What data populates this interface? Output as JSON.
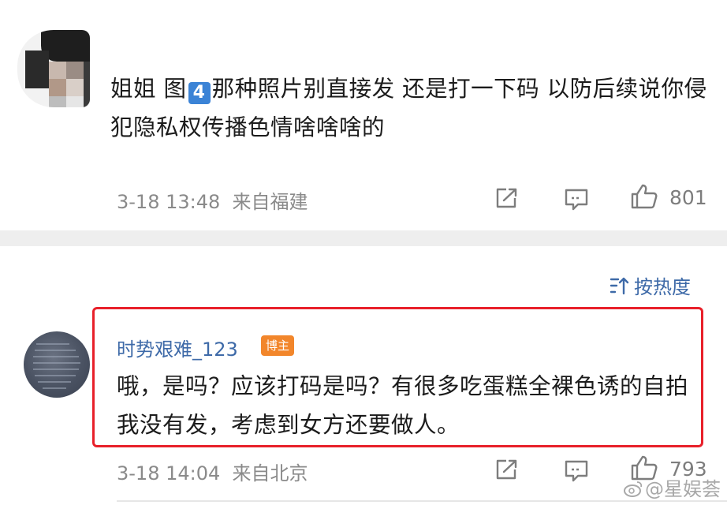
{
  "comment1": {
    "text_before": "姐姐 图",
    "num_badge": "4",
    "text_after": "那种照片别直接发 还是打一下码 以防后续说你侵犯隐私权传播色情啥啥啥的",
    "timestamp": "3-18 13:48",
    "location": "来自福建",
    "like_count": "801"
  },
  "sort": {
    "label": "按热度"
  },
  "comment2": {
    "username": "时势艰难_123",
    "badge": "博主",
    "text": "哦，是吗？应该打码是吗？有很多吃蛋糕全裸色诱的自拍我没有发，考虑到女方还要做人。",
    "timestamp": "3-18 14:04",
    "location": "来自北京",
    "like_count": "793"
  },
  "watermark": {
    "text": "@星娱荟"
  },
  "colors": {
    "link": "#3e6aa8",
    "highlight": "#e8202a",
    "badge": "#f2862b",
    "meta": "#8a8a8a"
  },
  "icons": [
    "share-icon",
    "comment-icon",
    "like-icon",
    "sort-icon",
    "weibo-icon"
  ]
}
